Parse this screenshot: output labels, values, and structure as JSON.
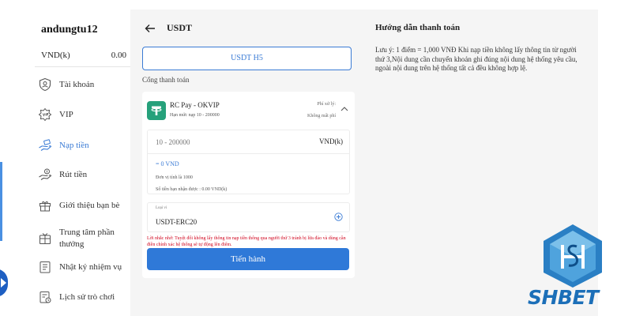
{
  "sidebar": {
    "username": "andungtu12",
    "balance_label": "VND(k)",
    "balance_value": "0.00",
    "items": [
      {
        "label": "Tài khoản",
        "icon": "user-shield-icon",
        "active": false
      },
      {
        "label": "VIP",
        "icon": "vip-badge-icon",
        "active": false
      },
      {
        "label": "Nạp tiền",
        "icon": "deposit-hand-icon",
        "active": true
      },
      {
        "label": "Rút tiền",
        "icon": "withdraw-hand-icon",
        "active": false
      },
      {
        "label": "Giới thiệu bạn bè",
        "icon": "gift-icon",
        "active": false
      },
      {
        "label": "Trung tâm phần thưởng",
        "icon": "reward-box-icon",
        "active": false
      },
      {
        "label": "Nhật ký nhiệm vụ",
        "icon": "task-log-icon",
        "active": false
      },
      {
        "label": "Lịch sử trò chơi",
        "icon": "history-icon",
        "active": false
      }
    ]
  },
  "header": {
    "title": "USDT",
    "back_icon": "arrow-left-icon"
  },
  "method": {
    "selected_label": "USDT H5"
  },
  "gateway": {
    "section_label": "Cổng thanh toán",
    "name": "RC Pay - OKVIP",
    "limit": "Hạn mức nạp 10 - 200000",
    "fee_label": "Phí xử lý:",
    "fee_value": "Không mất phí",
    "icon": "tether-icon"
  },
  "amount": {
    "placeholder": "10 - 200000",
    "unit": "VND(k)",
    "converted": "= 0 VND",
    "unit_note": "Đơn vị tính là 1000",
    "received_note": "Số tiền bạn nhận được : 0.00 VND(k)"
  },
  "coin": {
    "label": "Loại vi",
    "value": "USDT-ERC20"
  },
  "warning": "Lời nhắc nhở: Tuyệt đối không lấy thông tin nạp tiền thông qua người thứ 3 tránh bị lừa đảo và dùng cần điền chính xác hệ thống sẽ tự động lên điểm.",
  "submit_label": "Tiến hành",
  "guide": {
    "title": "Hướng dẫn thanh toán",
    "text": "Lưu ý: 1 điểm = 1,000 VNĐ Khi nạp tiền không lấy thông tin từ người thứ 3,Nội dung cần chuyển khoản ghi đúng nội dung hệ thống yêu cầu, ngoài nội dung trên hệ thống tất cả đều không hợp lệ."
  },
  "brand": {
    "name": "SHBET",
    "color": "#1c6fb8"
  },
  "colors": {
    "accent": "#3a7bd5",
    "button": "#2f79d8",
    "warning": "#d0021b",
    "tether": "#26a17b"
  }
}
